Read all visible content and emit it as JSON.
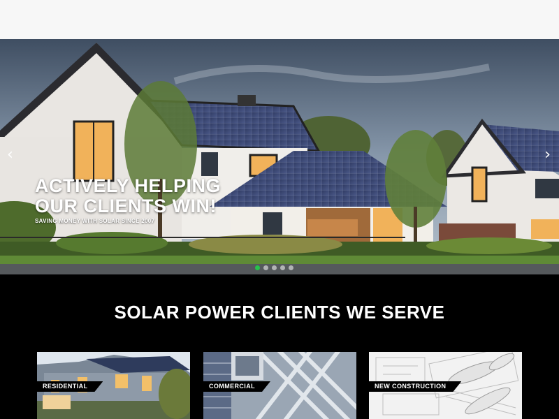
{
  "hero": {
    "headline_line1": "ACTIVELY HELPING",
    "headline_line2": "OUR CLIENTS WIN!",
    "tagline": "SAVING MONEY WITH SOLAR SINCE 2007",
    "prev_icon": "‹",
    "next_icon": "›",
    "slide_count": 5,
    "active_slide": 1
  },
  "section": {
    "title": "SOLAR POWER CLIENTS WE SERVE"
  },
  "cards": [
    {
      "label": "RESIDENTIAL"
    },
    {
      "label": "COMMERCIAL"
    },
    {
      "label": "NEW CONSTRUCTION"
    }
  ],
  "colors": {
    "accent": "#27c24c",
    "background": "#000000",
    "topbar": "#f7f7f7"
  }
}
